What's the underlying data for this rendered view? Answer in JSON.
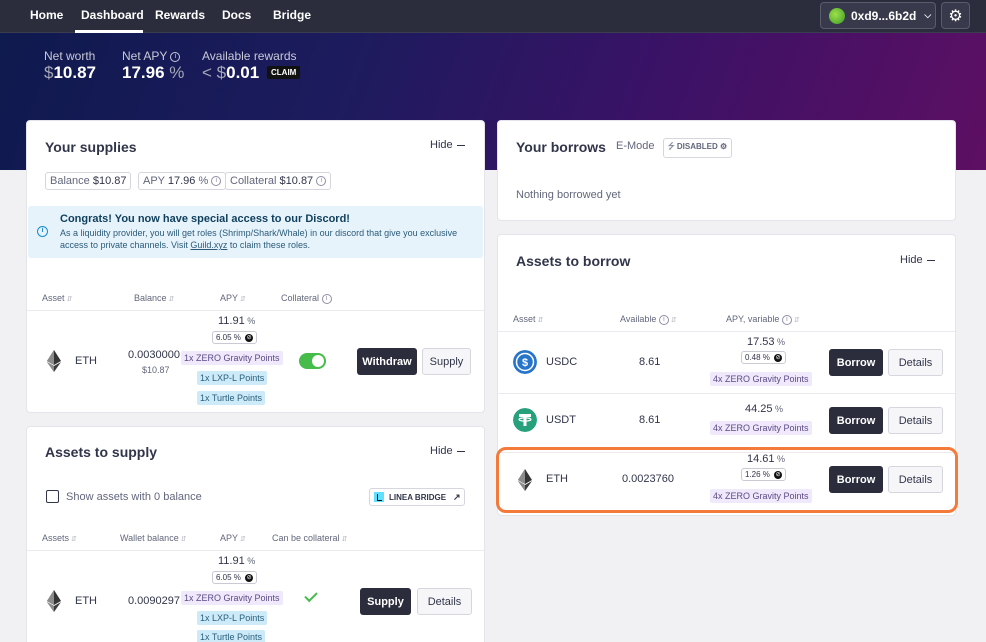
{
  "nav": {
    "items": [
      "Home",
      "Dashboard",
      "Rewards",
      "Docs",
      "Bridge"
    ],
    "wallet": "0xd9...6b2d"
  },
  "overview": {
    "net_worth_label": "Net worth",
    "net_worth_value": "10.87",
    "net_apy_label": "Net APY",
    "net_apy_value": "17.96",
    "rewards_label": "Available rewards",
    "rewards_value": "0.01",
    "claim_label": "CLAIM"
  },
  "supplies": {
    "title": "Your supplies",
    "hide": "Hide",
    "balance_label": "Balance",
    "balance_value": "$10.87",
    "apy_label": "APY",
    "apy_value": "17.96",
    "collateral_label": "Collateral",
    "collateral_value": "$10.87",
    "banner_title": "Congrats! You now have special access to our Discord!",
    "banner_body_1": "As a liquidity provider, you will get roles (Shrimp/Shark/Whale) in our discord that give you exclusive access to private channels. Visit ",
    "banner_link": "Guild.xyz",
    "banner_body_2": " to claim these roles.",
    "headers": [
      "Asset",
      "Balance",
      "APY",
      "Collateral"
    ],
    "row": {
      "asset": "ETH",
      "balance": "0.0030000",
      "balance_usd": "$10.87",
      "apy": "11.91",
      "apy_sub": "6.05",
      "tags": [
        "1x ZERO Gravity Points",
        "1x LXP-L Points",
        "1x Turtle Points"
      ],
      "withdraw": "Withdraw",
      "supply": "Supply"
    }
  },
  "to_supply": {
    "title": "Assets to supply",
    "hide": "Hide",
    "show_zero": "Show assets with 0 balance",
    "linea_bridge": "LINEA BRIDGE",
    "headers": [
      "Assets",
      "Wallet balance",
      "APY",
      "Can be collateral"
    ],
    "row": {
      "asset": "ETH",
      "balance": "0.0090297",
      "apy": "11.91",
      "apy_sub": "6.05",
      "tags": [
        "1x ZERO Gravity Points",
        "1x LXP-L Points",
        "1x Turtle Points"
      ],
      "supply": "Supply",
      "details": "Details"
    }
  },
  "borrows": {
    "title": "Your borrows",
    "emode_label": "E-Mode",
    "emode_status": "DISABLED",
    "empty": "Nothing borrowed yet"
  },
  "to_borrow": {
    "title": "Assets to borrow",
    "hide": "Hide",
    "headers": [
      "Asset",
      "Available",
      "APY, variable"
    ],
    "rows": [
      {
        "asset": "USDC",
        "available": "8.61",
        "apy": "17.53",
        "apy_sub": "0.48",
        "tag": "4x ZERO Gravity Points",
        "borrow": "Borrow",
        "details": "Details"
      },
      {
        "asset": "USDT",
        "available": "8.61",
        "apy": "44.25",
        "tag": "4x ZERO Gravity Points",
        "borrow": "Borrow",
        "details": "Details"
      },
      {
        "asset": "ETH",
        "available": "0.0023760",
        "apy": "14.61",
        "apy_sub": "1.26",
        "tag": "4x ZERO Gravity Points",
        "borrow": "Borrow",
        "details": "Details"
      }
    ]
  },
  "colors": {
    "accent_dark": "#2b2d3c",
    "toggle_green": "#46bc4b",
    "highlight": "#f47a3c"
  }
}
